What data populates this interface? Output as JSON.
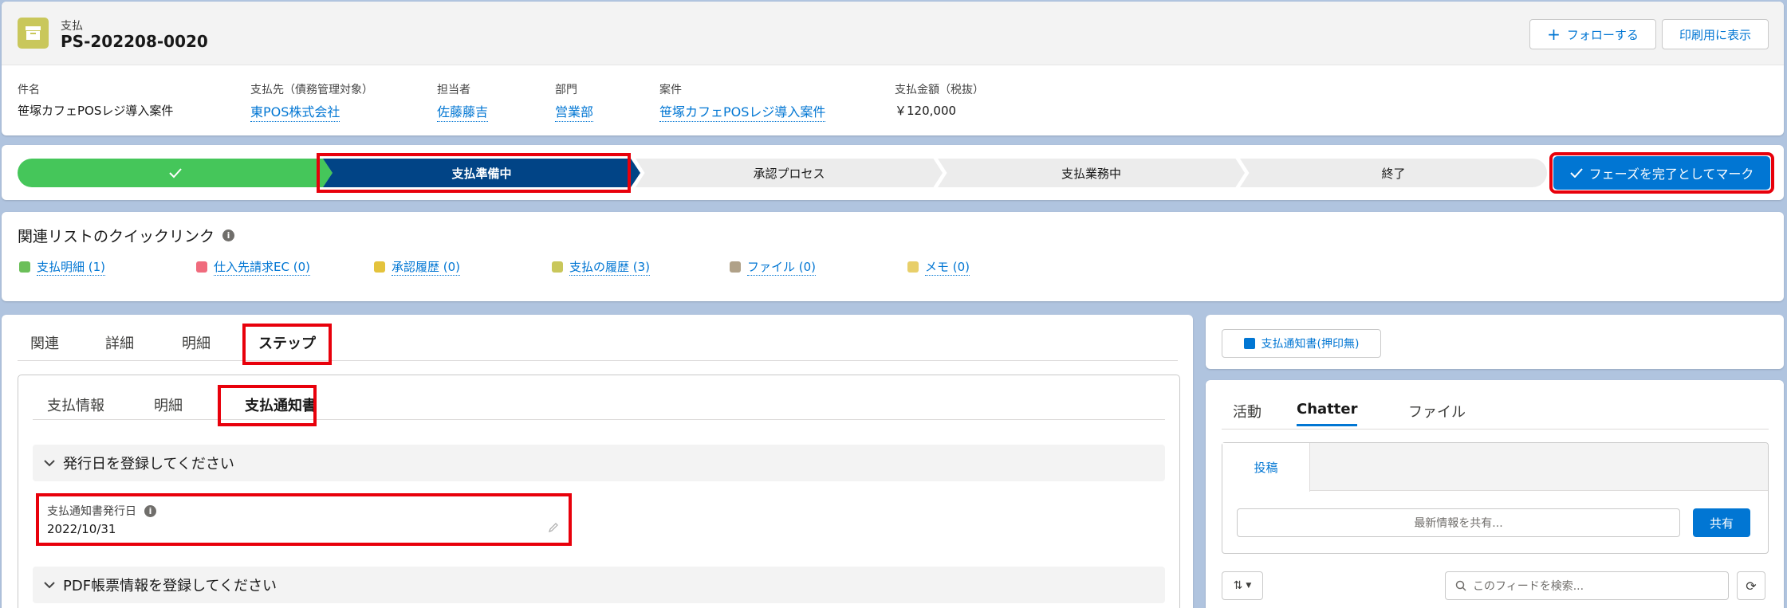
{
  "header": {
    "object_type": "支払",
    "record_name": "PS-202208-0020",
    "follow_label": "フォローする",
    "print_label": "印刷用に表示",
    "fields": [
      {
        "label": "件名",
        "value": "笹塚カフェPOSレジ導入案件",
        "link": false
      },
      {
        "label": "支払先（債務管理対象）",
        "value": "東POS株式会社",
        "link": true
      },
      {
        "label": "担当者",
        "value": "佐藤藤吉",
        "link": true
      },
      {
        "label": "部門",
        "value": "営業部",
        "link": true
      },
      {
        "label": "案件",
        "value": "笹塚カフェPOSレジ導入案件",
        "link": true
      },
      {
        "label": "支払金額（税抜）",
        "value": "￥120,000",
        "link": false
      }
    ]
  },
  "path": {
    "stages": [
      "",
      "支払準備中",
      "承認プロセス",
      "支払業務中",
      "終了"
    ],
    "mark_complete_label": "フェーズを完了としてマーク"
  },
  "quick_links": {
    "title": "関連リストのクイックリンク",
    "items": [
      {
        "label": "支払明細 (1)",
        "color": "#6bbf59"
      },
      {
        "label": "仕入先請求EC (0)",
        "color": "#f06b7d"
      },
      {
        "label": "承認履歴 (0)",
        "color": "#e4c33c"
      },
      {
        "label": "支払の履歴 (3)",
        "color": "#c9c75b"
      },
      {
        "label": "ファイル (0)",
        "color": "#b0a188"
      },
      {
        "label": "メモ (0)",
        "color": "#e8cf6a"
      }
    ]
  },
  "main_tabs": [
    "関連",
    "詳細",
    "明細",
    "ステップ"
  ],
  "sub_tabs": [
    "支払情報",
    "明細",
    "支払通知書"
  ],
  "sections": {
    "issue_date_header": "発行日を登録してください",
    "pdf_header": "PDF帳票情報を登録してください"
  },
  "issue_field": {
    "label": "支払通知書発行日",
    "value": "2022/10/31"
  },
  "side": {
    "doc_button_label": "支払通知書(押印無)",
    "feed_tabs": [
      "活動",
      "Chatter",
      "ファイル"
    ],
    "publisher_tab": "投稿",
    "share_placeholder": "最新情報を共有...",
    "share_button": "共有",
    "search_placeholder": "このフィードを検索..."
  }
}
